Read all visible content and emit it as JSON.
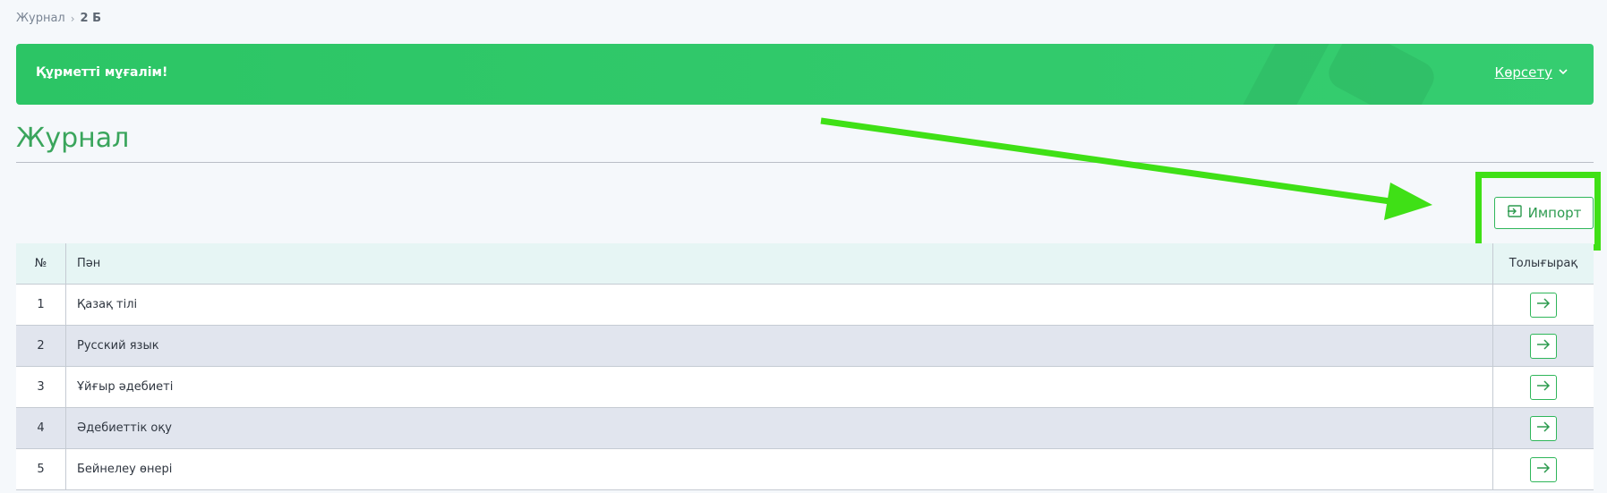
{
  "breadcrumb": {
    "root": "Журнал",
    "separator": "›",
    "current": "2 Б"
  },
  "banner": {
    "title": "Құрметті мұғалім!",
    "show_label": "Көрсету",
    "show_icon": "chevron-down-icon"
  },
  "page_title": "Журнал",
  "import_button": {
    "label": "Импорт",
    "icon": "import-icon"
  },
  "table": {
    "headers": {
      "num": "№",
      "subject": "Пән",
      "more": "Толығырақ"
    },
    "rows": [
      {
        "num": "1",
        "subject": "Қазақ тілі"
      },
      {
        "num": "2",
        "subject": "Русский язык"
      },
      {
        "num": "3",
        "subject": "Ұйғыр әдебиеті"
      },
      {
        "num": "4",
        "subject": "Әдебиеттік оқу"
      },
      {
        "num": "5",
        "subject": "Бейнелеу өнері"
      }
    ]
  },
  "colors": {
    "accent": "#2fb65a",
    "banner": "#2cc565",
    "annotation": "#3fe016",
    "title": "#3aa55c"
  }
}
